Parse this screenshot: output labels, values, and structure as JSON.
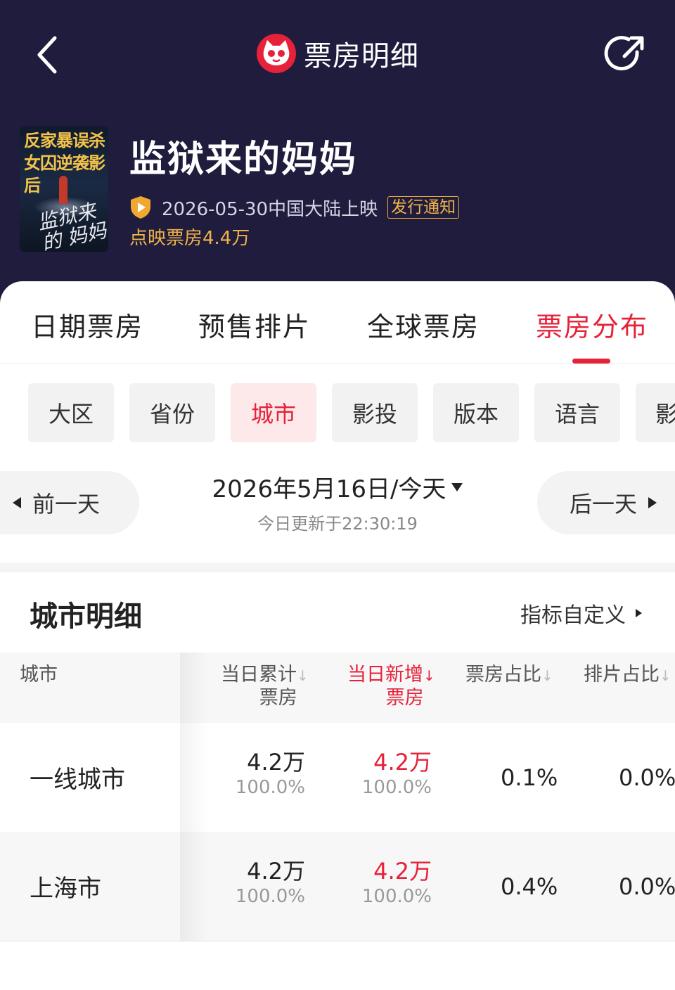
{
  "header": {
    "title": "票房明细",
    "colors": {
      "background": "#1f1c3d",
      "accent": "#e6223a",
      "gold": "#f0b347"
    }
  },
  "movie": {
    "title": "监狱来的妈妈",
    "poster_top_text": "反家暴误杀 女囚逆袭影后",
    "poster_script_text": "监狱来的 妈妈",
    "release_text": "2026-05-30中国大陆上映",
    "notice_badge": "发行通知",
    "preview_box_office": "点映票房4.4万"
  },
  "tabs": [
    {
      "label": "日期票房",
      "active": false
    },
    {
      "label": "预售排片",
      "active": false
    },
    {
      "label": "全球票房",
      "active": false
    },
    {
      "label": "票房分布",
      "active": true
    }
  ],
  "filter_chips": [
    {
      "label": "大区",
      "active": false
    },
    {
      "label": "省份",
      "active": false
    },
    {
      "label": "城市",
      "active": true
    },
    {
      "label": "影投",
      "active": false
    },
    {
      "label": "版本",
      "active": false
    },
    {
      "label": "语言",
      "active": false
    },
    {
      "label": "影",
      "active": false
    }
  ],
  "date_nav": {
    "prev_label": "前一天",
    "next_label": "后一天",
    "current_date": "2026年5月16日/今天",
    "update_time": "今日更新于22:30:19"
  },
  "section": {
    "title": "城市明细",
    "customize_label": "指标自定义"
  },
  "table": {
    "headers": {
      "city": "城市",
      "cumulative_line1": "当日累计",
      "cumulative_line2": "票房",
      "new_line1": "当日新增",
      "new_line2": "票房",
      "box_share": "票房占比",
      "screening_share": "排片占比"
    },
    "rows": [
      {
        "city": "一线城市",
        "cumulative": "4.2万",
        "cumulative_pct": "100.0%",
        "new": "4.2万",
        "new_pct": "100.0%",
        "box_share": "0.1%",
        "screening_share": "0.0%"
      },
      {
        "city": "上海市",
        "cumulative": "4.2万",
        "cumulative_pct": "100.0%",
        "new": "4.2万",
        "new_pct": "100.0%",
        "box_share": "0.4%",
        "screening_share": "0.0%"
      }
    ]
  },
  "icons": {
    "back": "chevron-left-icon",
    "share": "share-icon",
    "logo": "cat-logo-icon",
    "release": "shield-play-icon"
  }
}
